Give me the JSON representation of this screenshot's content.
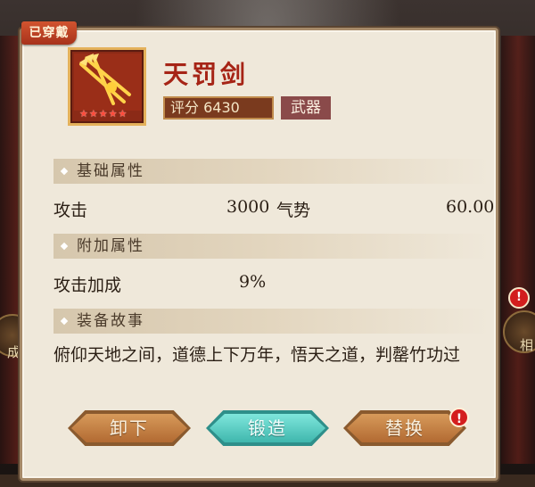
{
  "badge": {
    "worn": "已穿戴"
  },
  "item": {
    "name": "天罚剑",
    "stars": "★★★★★",
    "score": "评分 6430",
    "type": "武器"
  },
  "sections": {
    "base": "基础属性",
    "extra": "附加属性",
    "story": "装备故事"
  },
  "base_stats": [
    {
      "label": "攻击",
      "value": "3000"
    },
    {
      "label": "气势",
      "value": "60.00"
    }
  ],
  "extra_stats": [
    {
      "label": "攻击加成",
      "value": "9%"
    }
  ],
  "story_text": "俯仰天地之间，道德上下万年，悟天之道，判罄竹功过",
  "buttons": {
    "unequip": "卸下",
    "forge": "锻造",
    "replace": "替换"
  },
  "alert_mark": "!",
  "background": {
    "left_text": "成",
    "right_text": "相"
  },
  "colors": {
    "panel_bg": "#efe8da",
    "title_red": "#a62416",
    "button_brown": "#b26a32",
    "button_teal": "#3fb7ad",
    "alert_red": "#d41e1e"
  }
}
